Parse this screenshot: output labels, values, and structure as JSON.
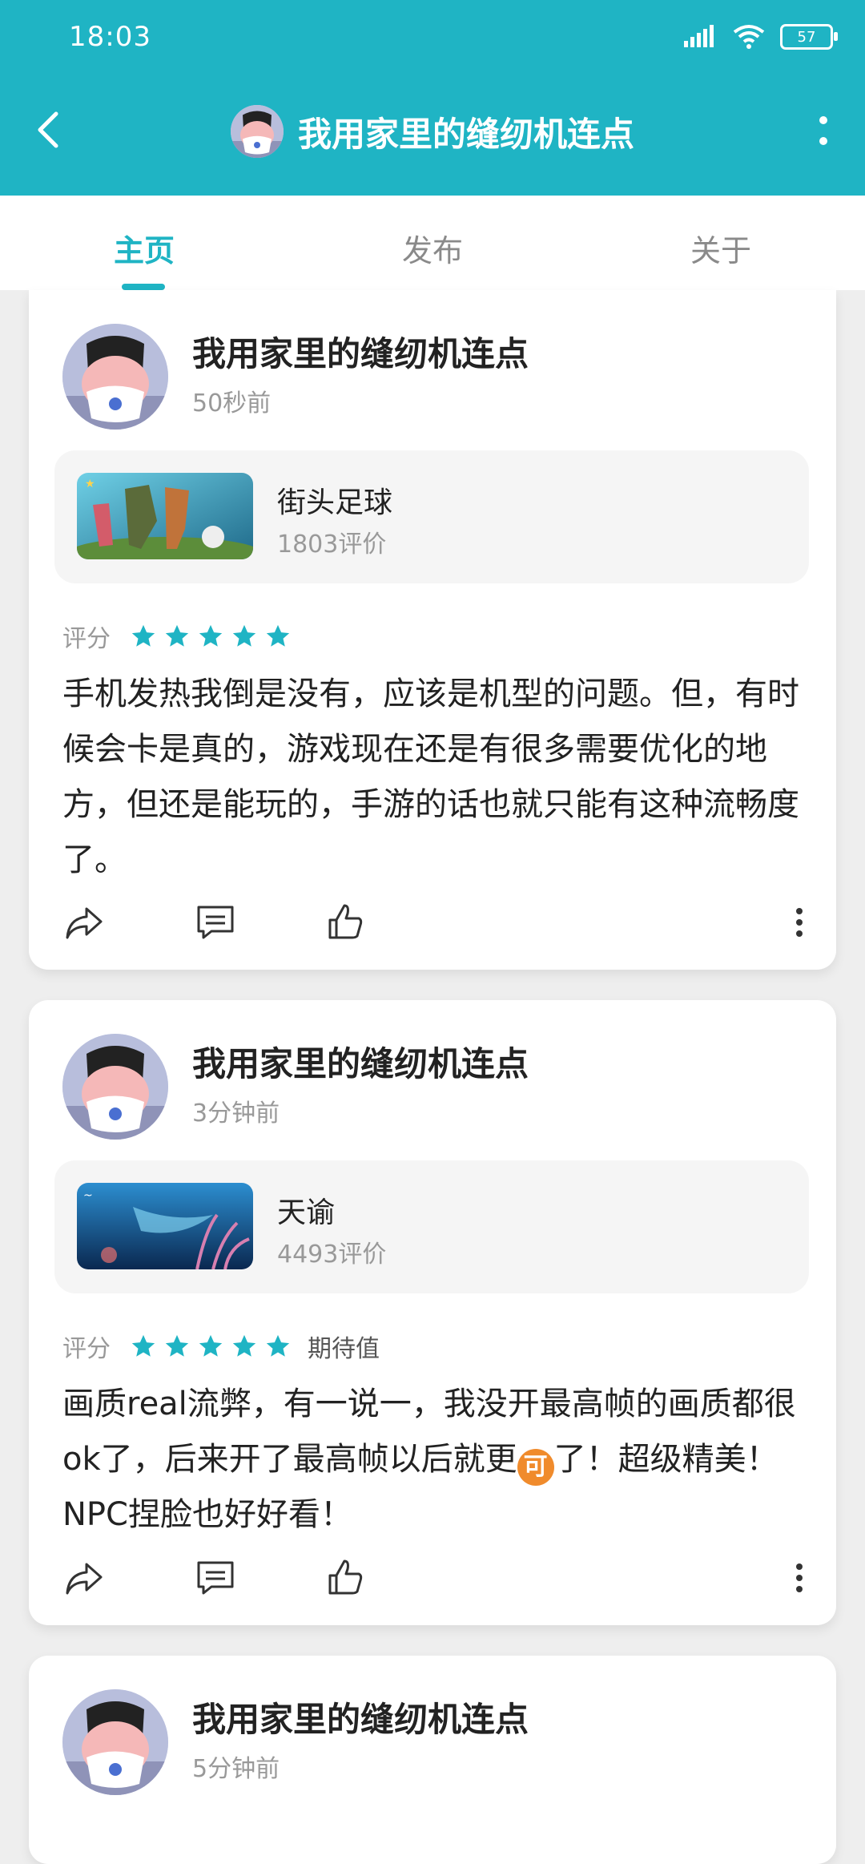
{
  "status_bar": {
    "time": "18:03",
    "battery": "57"
  },
  "header": {
    "title": "我用家里的缝纫机连点"
  },
  "tabs": [
    {
      "label": "主页",
      "active": true
    },
    {
      "label": "发布",
      "active": false
    },
    {
      "label": "关于",
      "active": false
    }
  ],
  "posts": [
    {
      "username": "我用家里的缝纫机连点",
      "time": "50秒前",
      "game": {
        "name": "街头足球",
        "reviews": "1803评价"
      },
      "rating_label": "评分",
      "stars": 5,
      "expect": "",
      "text": "手机发热我倒是没有，应该是机型的问题。但，有时候会卡是真的，游戏现在还是有很多需要优化的地方，但还是能玩的，手游的话也就只能有这种流畅度了。"
    },
    {
      "username": "我用家里的缝纫机连点",
      "time": "3分钟前",
      "game": {
        "name": "天谕",
        "reviews": "4493评价"
      },
      "rating_label": "评分",
      "stars": 5,
      "expect": "期待值",
      "text_part1": "画质real流弊，有一说一，我没开最高帧的画质都很ok了，后来开了最高帧以后就更",
      "emoji": "可",
      "text_part2": "了！超级精美！NPC捏脸也好好看！"
    },
    {
      "username": "我用家里的缝纫机连点",
      "time": "5分钟前"
    }
  ],
  "colors": {
    "accent": "#1fb4c4",
    "card_bg": "#ffffff",
    "page_bg": "#eeeeee"
  },
  "icons": [
    "back-icon",
    "more-vertical-icon",
    "share-icon",
    "comment-icon",
    "like-icon",
    "more-icon",
    "star-icon",
    "signal-icon",
    "wifi-icon",
    "battery-icon"
  ]
}
